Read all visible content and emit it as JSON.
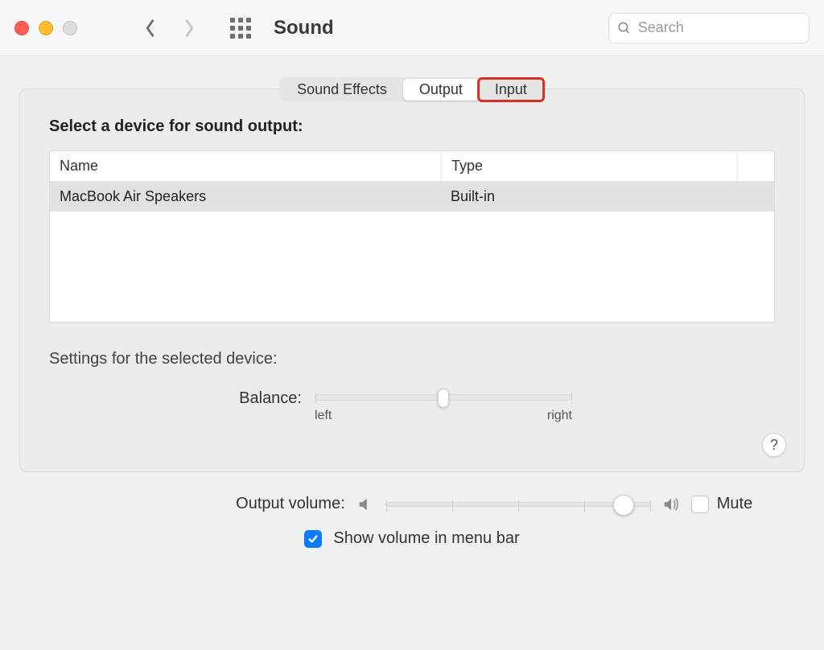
{
  "toolbar": {
    "title": "Sound",
    "search_placeholder": "Search"
  },
  "tabs": {
    "sound_effects": "Sound Effects",
    "output": "Output",
    "input": "Input",
    "active": "output"
  },
  "highlight_tab": "input",
  "section": {
    "heading": "Select a device for sound output:"
  },
  "table": {
    "columns": {
      "name": "Name",
      "type": "Type"
    },
    "rows": [
      {
        "name": "MacBook Air Speakers",
        "type": "Built-in",
        "selected": true
      }
    ]
  },
  "settings": {
    "label": "Settings for the selected device:",
    "balance_label": "Balance:",
    "balance_left": "left",
    "balance_right": "right",
    "balance_value": 50
  },
  "footer": {
    "output_volume_label": "Output volume:",
    "volume_value": 90,
    "mute_label": "Mute",
    "mute_checked": false,
    "show_in_menubar_label": "Show volume in menu bar",
    "show_in_menubar_checked": true
  },
  "help_label": "?",
  "colors": {
    "accent": "#0a7aff",
    "highlight": "#d93025"
  }
}
